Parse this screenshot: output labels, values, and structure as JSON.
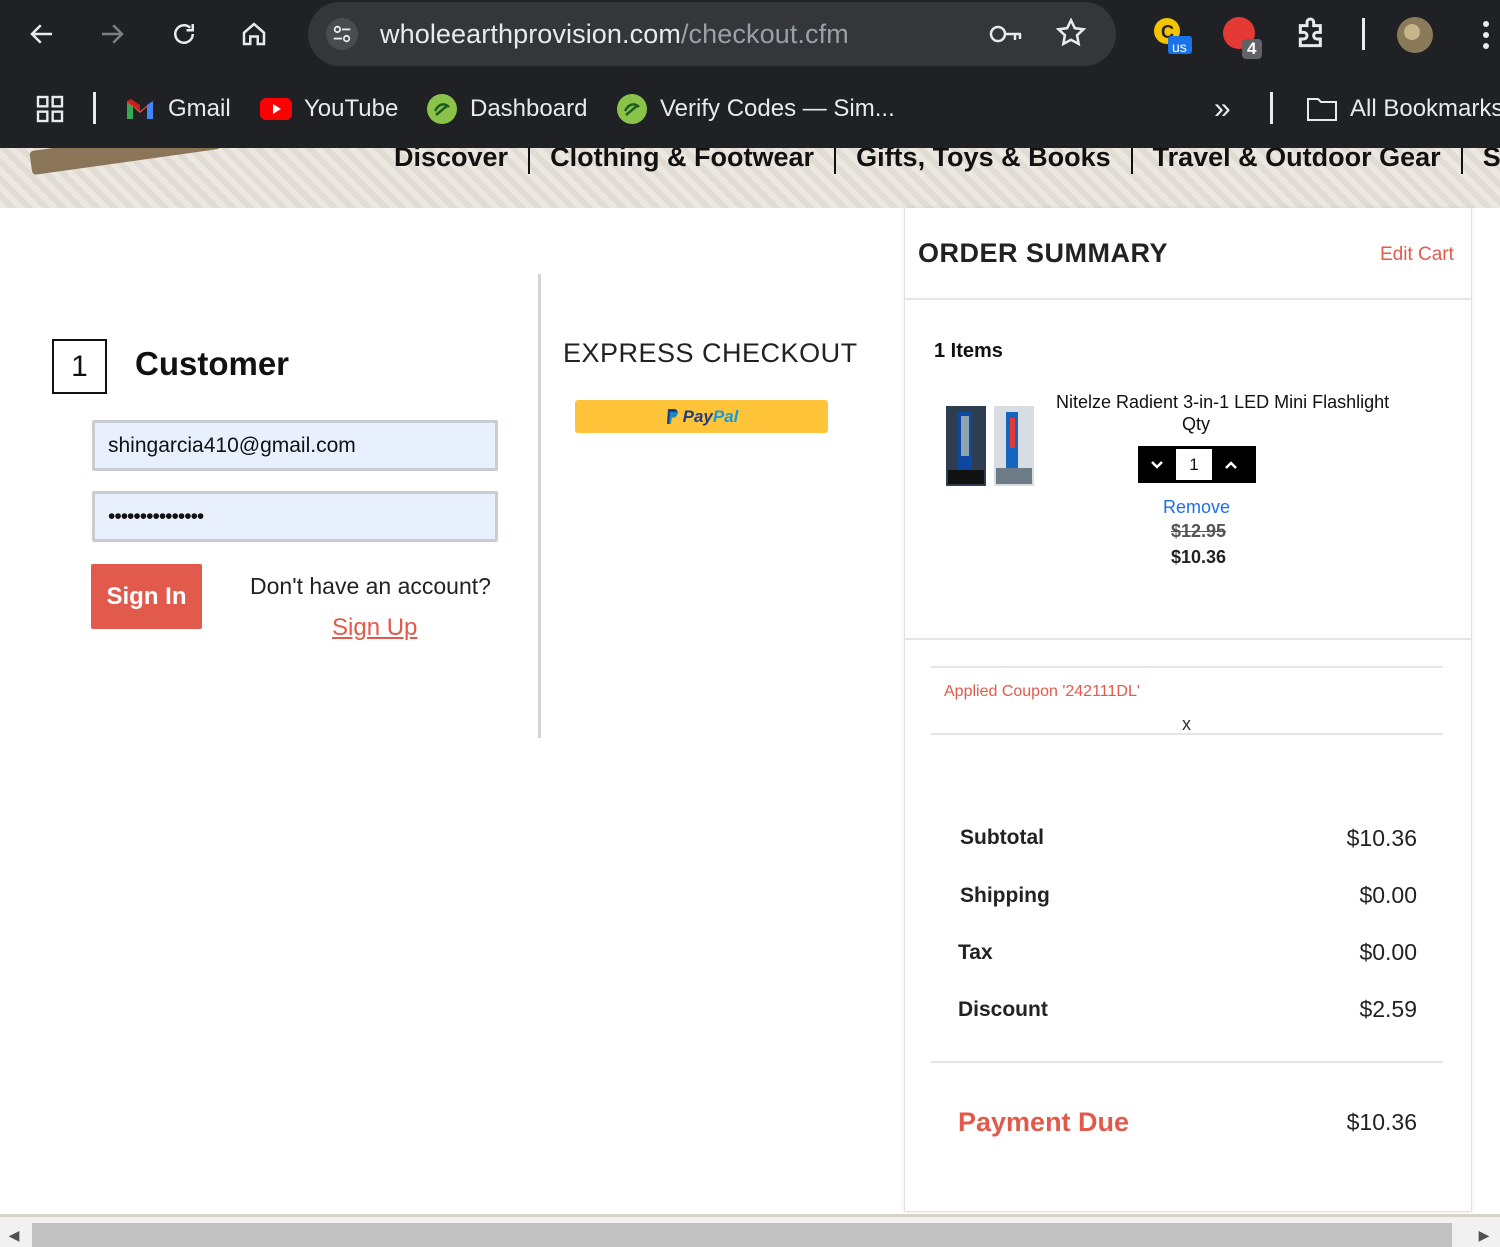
{
  "browser": {
    "url_domain": "wholeearthprovision.com",
    "url_path": "/checkout.cfm",
    "ext_badge_us": "us",
    "ext_badge_count": "4",
    "bookmarks": [
      {
        "label": "Gmail"
      },
      {
        "label": "YouTube"
      },
      {
        "label": "Dashboard"
      },
      {
        "label": "Verify Codes — Sim..."
      }
    ],
    "overflow": "»",
    "all_bookmarks": "All Bookmarks"
  },
  "site_nav": [
    "Discover",
    "Clothing & Footwear",
    "Gifts, Toys & Books",
    "Travel & Outdoor Gear",
    "SALE"
  ],
  "customer": {
    "step": "1",
    "title": "Customer",
    "email_value": "shingarcia410@gmail.com",
    "password_value": "•••••••••••••••",
    "sign_in_label": "Sign In",
    "no_account_text": "Don't have an account?",
    "sign_up_label": "Sign Up"
  },
  "express": {
    "title": "EXPRESS CHECKOUT",
    "paypal_a": "Pay",
    "paypal_b": "Pal"
  },
  "summary": {
    "title": "ORDER SUMMARY",
    "edit_cart": "Edit Cart",
    "items_count": "1 Items",
    "product_name": "Nitelze Radient 3-in-1 LED Mini Flashlight",
    "qty_label": "Qty",
    "qty_value": "1",
    "remove_label": "Remove",
    "old_price": "$12.95",
    "new_price": "$10.36",
    "coupon_text": "Applied Coupon '242111DL'",
    "coupon_remove": "x",
    "totals": [
      {
        "label": "Subtotal",
        "value": "$10.36"
      },
      {
        "label": "Shipping",
        "value": "$0.00"
      },
      {
        "label": "Tax",
        "value": "$0.00"
      },
      {
        "label": "Discount",
        "value": "$2.59"
      }
    ],
    "due_label": "Payment Due",
    "due_value": "$10.36"
  },
  "colors": {
    "accent": "#e25a4b",
    "link_blue": "#1e6ee8",
    "paypal_yellow": "#ffc439",
    "chrome_dark": "#202124"
  }
}
